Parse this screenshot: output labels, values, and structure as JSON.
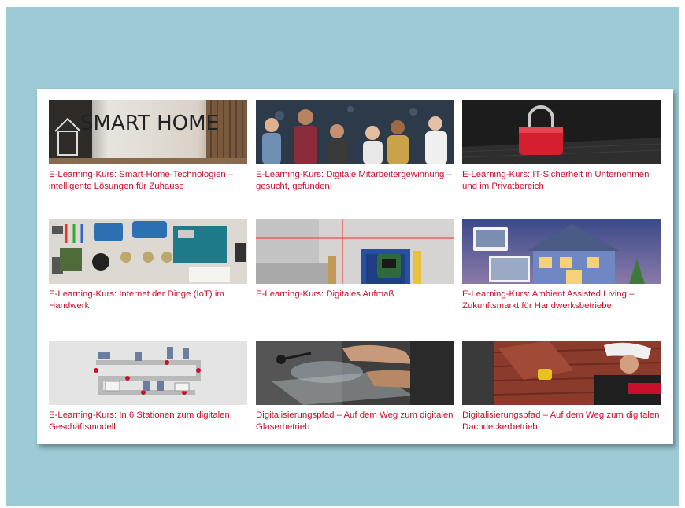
{
  "page": {
    "background_color": "#9ccbd6",
    "link_color": "#c8102e"
  },
  "tiles": [
    {
      "image": "smart-home-sign-image",
      "image_text": "SMART HOME",
      "title": "E-Learning-Kurs: Smart-Home-Technologien – intelligente Lösungen für Zuhause"
    },
    {
      "image": "group-of-people-image",
      "title": "E-Learning-Kurs: Digitale Mitarbeitergewinnung – gesucht, gefunden!"
    },
    {
      "image": "red-padlock-on-laptop-image",
      "title": "E-Learning-Kurs: IT-Sicherheit in Unternehmen und im Privatbereich"
    },
    {
      "image": "arduino-electronics-image",
      "title": "E-Learning-Kurs: Internet der Dinge (IoT) im Handwerk"
    },
    {
      "image": "laser-measuring-device-image",
      "title": "E-Learning-Kurs: Digitales Aufmaß"
    },
    {
      "image": "smart-house-with-devices-image",
      "title": "E-Learning-Kurs: Ambient Assisted Living – Zukunftsmarkt für Handwerksbetriebe"
    },
    {
      "image": "business-model-stations-diagram-image",
      "title": "E-Learning-Kurs: In 6 Stationen zum digitalen Geschäftsmodell"
    },
    {
      "image": "glazier-cutting-glass-image",
      "title": "Digitalisierungspfad – Auf dem Weg zum digitalen Glaserbetrieb"
    },
    {
      "image": "roofer-laying-tiles-image",
      "title": "Digitalisierungspfad – Auf dem Weg zum digitalen Dachdeckerbetrieb"
    }
  ]
}
